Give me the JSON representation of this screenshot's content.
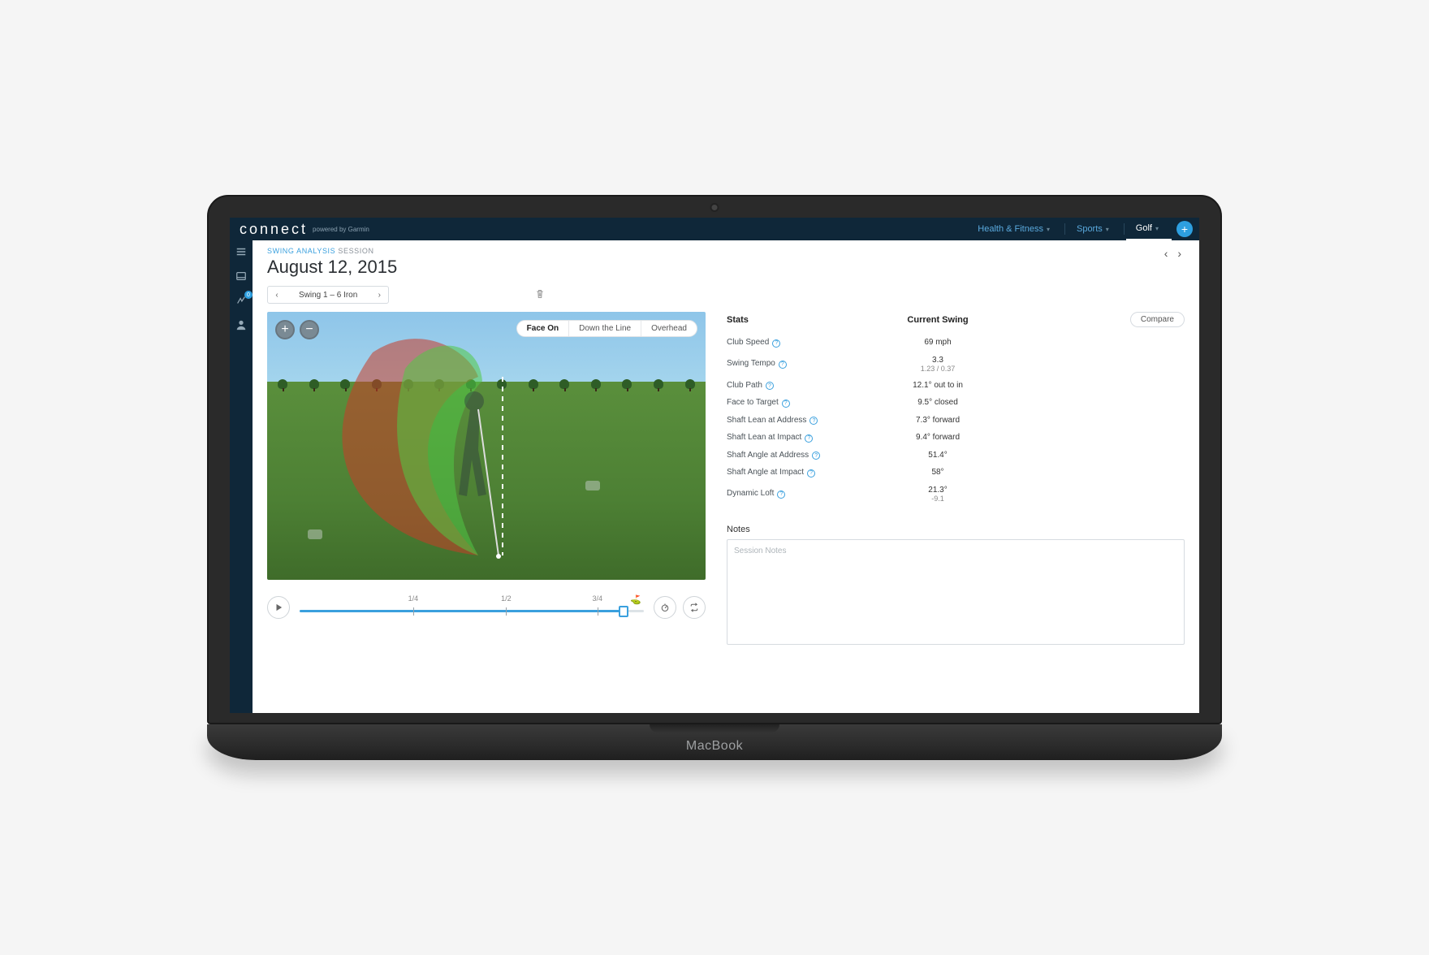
{
  "brand": {
    "name": "connect",
    "tagline": "powered by Garmin"
  },
  "nav": {
    "items": [
      {
        "label": "Health & Fitness"
      },
      {
        "label": "Sports"
      },
      {
        "label": "Golf"
      }
    ]
  },
  "sidebar": {
    "badge": "0"
  },
  "breadcrumb": {
    "a": "SWING ANALYSIS",
    "b": "SESSION"
  },
  "page": {
    "title": "August 12, 2015"
  },
  "swing_selector": {
    "label": "Swing 1 – 6 Iron"
  },
  "viz": {
    "tabs": [
      "Face On",
      "Down the Line",
      "Overhead"
    ],
    "active_tab": 0
  },
  "timeline": {
    "marks": [
      "1/4",
      "1/2",
      "3/4"
    ],
    "position_pct": 94
  },
  "stats": {
    "header": {
      "a": "Stats",
      "b": "Current Swing",
      "compare": "Compare"
    },
    "rows": [
      {
        "label": "Club Speed",
        "value": "69 mph"
      },
      {
        "label": "Swing Tempo",
        "value": "3.3",
        "sub": "1.23 / 0.37"
      },
      {
        "label": "Club Path",
        "value": "12.1° out to in"
      },
      {
        "label": "Face to Target",
        "value": "9.5° closed"
      },
      {
        "label": "Shaft Lean at Address",
        "value": "7.3° forward"
      },
      {
        "label": "Shaft Lean at Impact",
        "value": "9.4° forward"
      },
      {
        "label": "Shaft Angle at Address",
        "value": "51.4°"
      },
      {
        "label": "Shaft Angle at Impact",
        "value": "58°"
      },
      {
        "label": "Dynamic Loft",
        "value": "21.3°",
        "sub": "-9.1"
      }
    ]
  },
  "notes": {
    "label": "Notes",
    "placeholder": "Session Notes"
  },
  "laptop": {
    "logo": "MacBook"
  }
}
